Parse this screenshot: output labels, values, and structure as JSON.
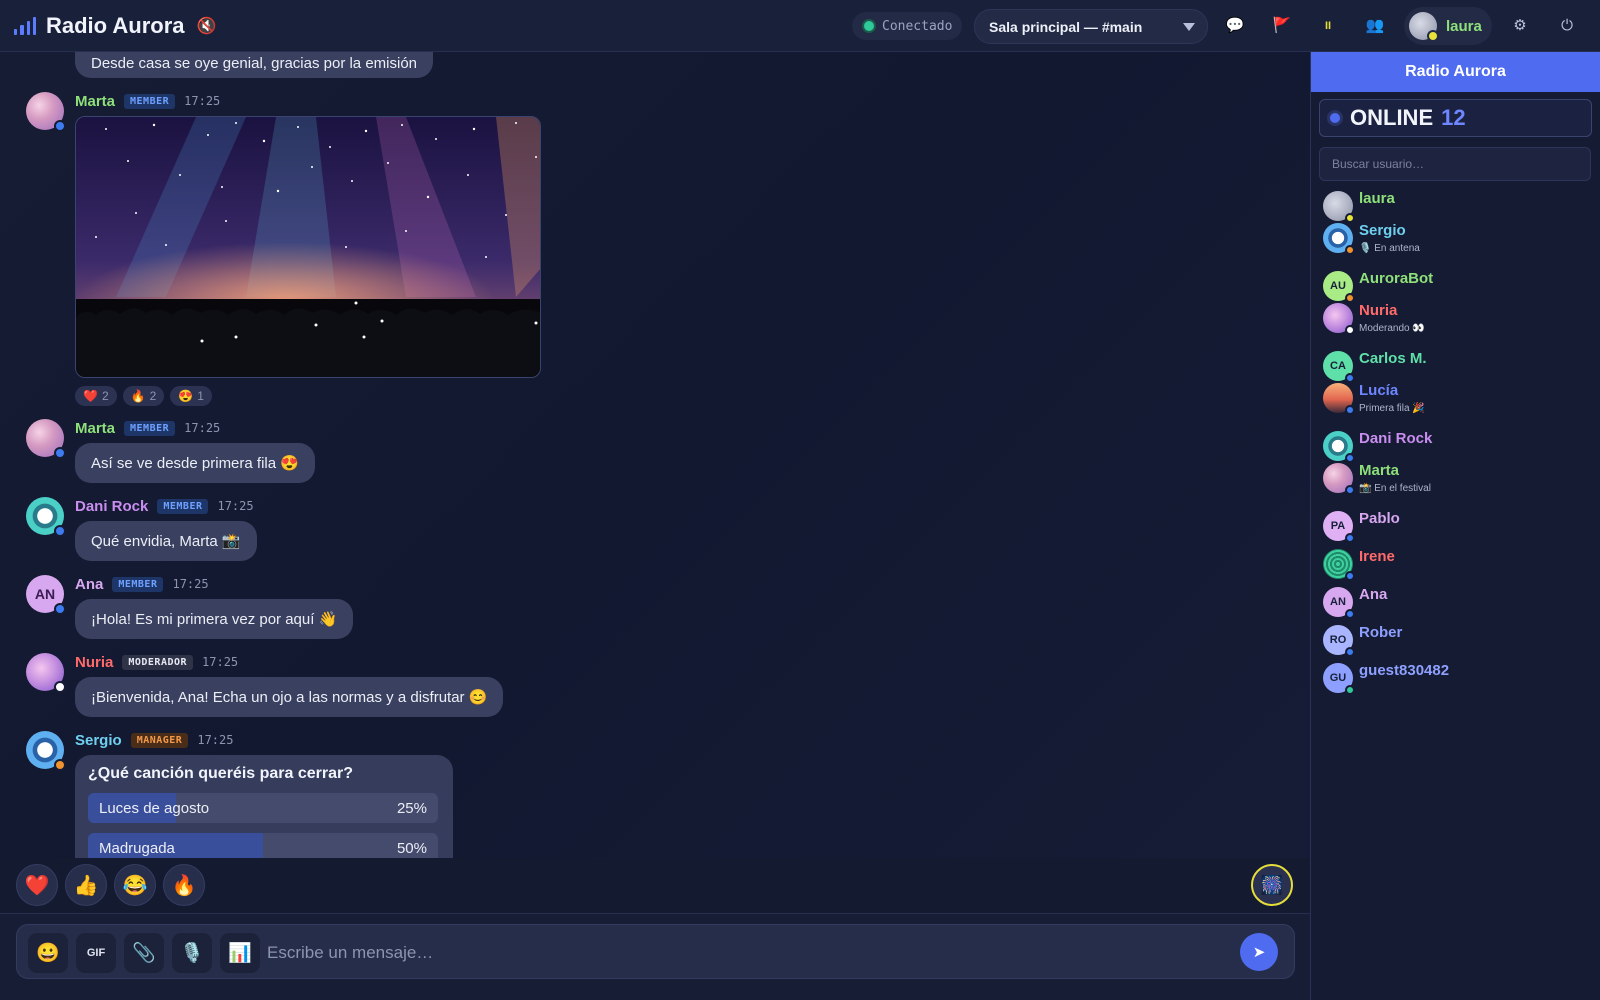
{
  "app": {
    "title": "Radio Aurora",
    "connection_status": "Conectado",
    "room": "Sala principal — #main",
    "current_user": "laura"
  },
  "toolbar_icons": [
    "chat-icon",
    "flag-icon",
    "pause-icon",
    "users-icon",
    "settings-icon",
    "power-icon"
  ],
  "messages": {
    "prev_text": "Desde casa se oye genial, gracias por la emisión",
    "m1": {
      "user": "Marta",
      "role": "MEMBER",
      "time": "17:25",
      "reactions": [
        {
          "emoji": "❤️",
          "count": "2"
        },
        {
          "emoji": "🔥",
          "count": "2"
        },
        {
          "emoji": "😍",
          "count": "1"
        }
      ]
    },
    "m2": {
      "user": "Marta",
      "role": "MEMBER",
      "time": "17:25",
      "text": "Así se ve desde primera fila 😍"
    },
    "m3": {
      "user": "Dani Rock",
      "role": "MEMBER",
      "time": "17:25",
      "text": "Qué envidia, Marta 📸"
    },
    "m4": {
      "user": "Ana",
      "role": "MEMBER",
      "time": "17:25",
      "text": "¡Hola! Es mi primera vez por aquí 👋",
      "initials": "AN"
    },
    "m5": {
      "user": "Nuria",
      "role": "MODERADOR",
      "time": "17:25",
      "text": "¡Bienvenida, Ana! Echa un ojo a las normas y a disfrutar 😊"
    },
    "m6": {
      "user": "Sergio",
      "role": "MANAGER",
      "time": "17:25",
      "poll": {
        "question": "¿Qué canción queréis para cerrar?",
        "options": [
          {
            "label": "Luces de agosto",
            "pct_label": "25%",
            "pct": 25
          },
          {
            "label": "Madrugada",
            "pct_label": "50%",
            "pct": 50
          }
        ]
      }
    }
  },
  "quick_reactions": [
    "❤️",
    "👍",
    "😂",
    "🔥"
  ],
  "fireworks_button": "🎆",
  "composer": {
    "placeholder": "Escribe un mensaje…",
    "buttons": {
      "emoji": "😀",
      "gif": "GIF",
      "attach": "📎",
      "mic": "🎙️",
      "poll": "📊"
    },
    "send": "➤"
  },
  "sidebar": {
    "title": "Radio Aurora",
    "online_label": "ONLINE",
    "online_count": "12",
    "search_placeholder": "Buscar usuario…",
    "users": [
      {
        "name": "laura",
        "status": ""
      },
      {
        "name": "Sergio",
        "status": "🎙️ En antena"
      },
      {
        "name": "AuroraBot",
        "status": "",
        "initials": "AU"
      },
      {
        "name": "Nuria",
        "status": "Moderando 👀"
      },
      {
        "name": "Carlos M.",
        "status": "",
        "initials": "CA"
      },
      {
        "name": "Lucía",
        "status": "Primera fila 🎉"
      },
      {
        "name": "Dani Rock",
        "status": ""
      },
      {
        "name": "Marta",
        "status": "📸 En el festival"
      },
      {
        "name": "Pablo",
        "status": "",
        "initials": "PA"
      },
      {
        "name": "Irene",
        "status": ""
      },
      {
        "name": "Ana",
        "status": "",
        "initials": "AN"
      },
      {
        "name": "Rober",
        "status": "",
        "initials": "RO"
      },
      {
        "name": "guest830482",
        "status": "",
        "initials": "GU"
      }
    ]
  },
  "colors": {
    "accent": "#4f6cf0",
    "marta": "#8ee07a",
    "dani": "#c98ef0",
    "ana": "#d7a7ef",
    "nuria": "#ff6b6b",
    "sergio": "#6fd0f0"
  }
}
